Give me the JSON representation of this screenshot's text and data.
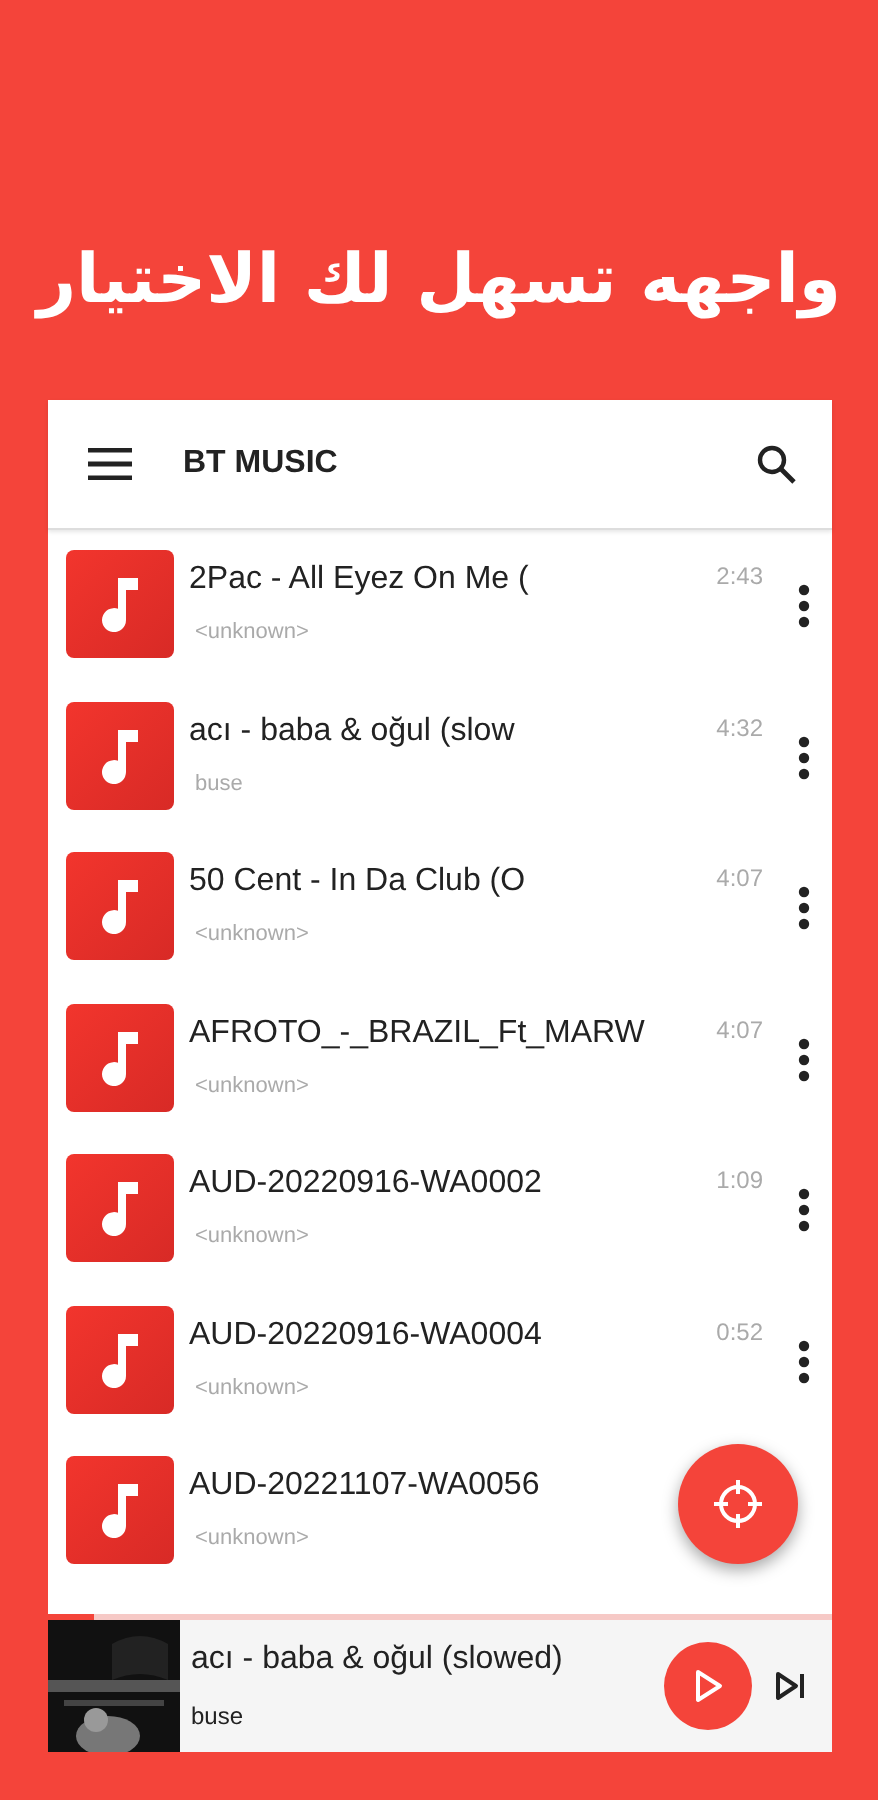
{
  "headline": "واجهه تسهل لك الاختيار",
  "toolbar": {
    "title": "BT MUSIC"
  },
  "songs": [
    {
      "title": "2Pac - All Eyez On Me (",
      "artist": "<unknown>",
      "duration": "2:43"
    },
    {
      "title": "acı - baba & oğul (slow",
      "artist": "buse",
      "duration": "4:32"
    },
    {
      "title": "50 Cent - In Da Club (O",
      "artist": "<unknown>",
      "duration": "4:07"
    },
    {
      "title": "AFROTO_-_BRAZIL_Ft_MARW",
      "artist": "<unknown>",
      "duration": "4:07"
    },
    {
      "title": "AUD-20220916-WA0002",
      "artist": "<unknown>",
      "duration": "1:09"
    },
    {
      "title": "AUD-20220916-WA0004",
      "artist": "<unknown>",
      "duration": "0:52"
    },
    {
      "title": "AUD-20221107-WA0056",
      "artist": "<unknown>"
    }
  ],
  "player": {
    "title": "acı - baba & oğul (slowed)",
    "artist": "buse",
    "level": 0.06,
    "playing": false
  }
}
